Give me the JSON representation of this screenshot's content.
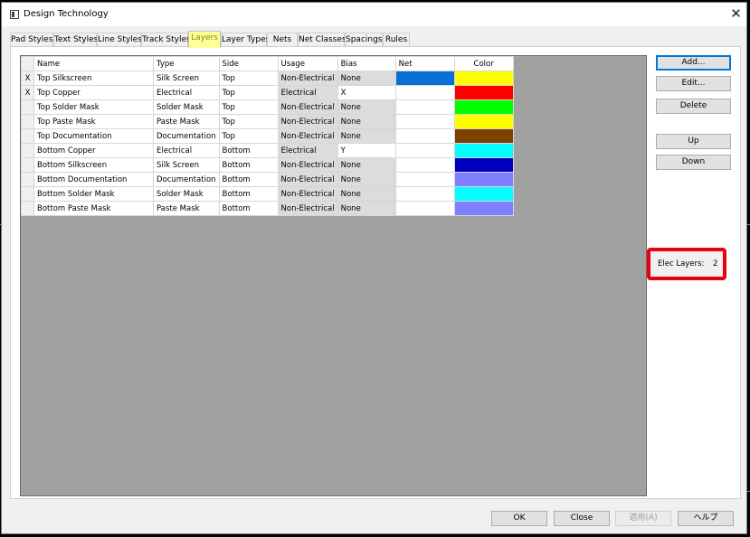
{
  "window": {
    "title": "Design Technology",
    "close_glyph": "✕"
  },
  "tabs": [
    {
      "label": "Pad Styles"
    },
    {
      "label": "Text Styles"
    },
    {
      "label": "Line Styles"
    },
    {
      "label": "Track Styles"
    },
    {
      "label": "Layers",
      "active": true
    },
    {
      "label": "Layer Types"
    },
    {
      "label": "Nets"
    },
    {
      "label": "Net Classes"
    },
    {
      "label": "Spacings"
    },
    {
      "label": "Rules"
    }
  ],
  "grid": {
    "columns": [
      "Name",
      "Type",
      "Side",
      "Usage",
      "Bias",
      "Net",
      "Color"
    ],
    "rows": [
      {
        "marker": "X",
        "name": "Top Silkscreen",
        "type": "Silk Screen",
        "side": "Top",
        "usage": "Non-Electrical",
        "bias": "None",
        "net_color": "#0a6fd6",
        "color": "#ffff00"
      },
      {
        "marker": "X",
        "name": "Top Copper",
        "type": "Electrical",
        "side": "Top",
        "usage": "Electrical",
        "bias": "X",
        "net_color": "",
        "color": "#ff0000"
      },
      {
        "marker": "",
        "name": "Top Solder Mask",
        "type": "Solder Mask",
        "side": "Top",
        "usage": "Non-Electrical",
        "bias": "None",
        "net_color": "",
        "color": "#00ff00"
      },
      {
        "marker": "",
        "name": "Top Paste Mask",
        "type": "Paste Mask",
        "side": "Top",
        "usage": "Non-Electrical",
        "bias": "None",
        "net_color": "",
        "color": "#ffff00"
      },
      {
        "marker": "",
        "name": "Top Documentation",
        "type": "Documentation",
        "side": "Top",
        "usage": "Non-Electrical",
        "bias": "None",
        "net_color": "",
        "color": "#804000"
      },
      {
        "marker": "",
        "name": "Bottom Copper",
        "type": "Electrical",
        "side": "Bottom",
        "usage": "Electrical",
        "bias": "Y",
        "net_color": "",
        "color": "#00ffff"
      },
      {
        "marker": "",
        "name": "Bottom Silkscreen",
        "type": "Silk Screen",
        "side": "Bottom",
        "usage": "Non-Electrical",
        "bias": "None",
        "net_color": "",
        "color": "#0000c0"
      },
      {
        "marker": "",
        "name": "Bottom Documentation",
        "type": "Documentation",
        "side": "Bottom",
        "usage": "Non-Electrical",
        "bias": "None",
        "net_color": "",
        "color": "#7f7fff"
      },
      {
        "marker": "",
        "name": "Bottom Solder Mask",
        "type": "Solder Mask",
        "side": "Bottom",
        "usage": "Non-Electrical",
        "bias": "None",
        "net_color": "",
        "color": "#00ffff"
      },
      {
        "marker": "",
        "name": "Bottom Paste Mask",
        "type": "Paste Mask",
        "side": "Bottom",
        "usage": "Non-Electrical",
        "bias": "None",
        "net_color": "",
        "color": "#8080ff"
      }
    ]
  },
  "side_buttons": {
    "add": "Add...",
    "edit": "Edit...",
    "delete": "Delete",
    "up": "Up",
    "down": "Down"
  },
  "elec_layers": {
    "label": "Elec Layers:",
    "value": "2"
  },
  "footer_buttons": {
    "ok": "OK",
    "close": "Close",
    "apply": "適用(A)",
    "help": "ヘルプ"
  }
}
